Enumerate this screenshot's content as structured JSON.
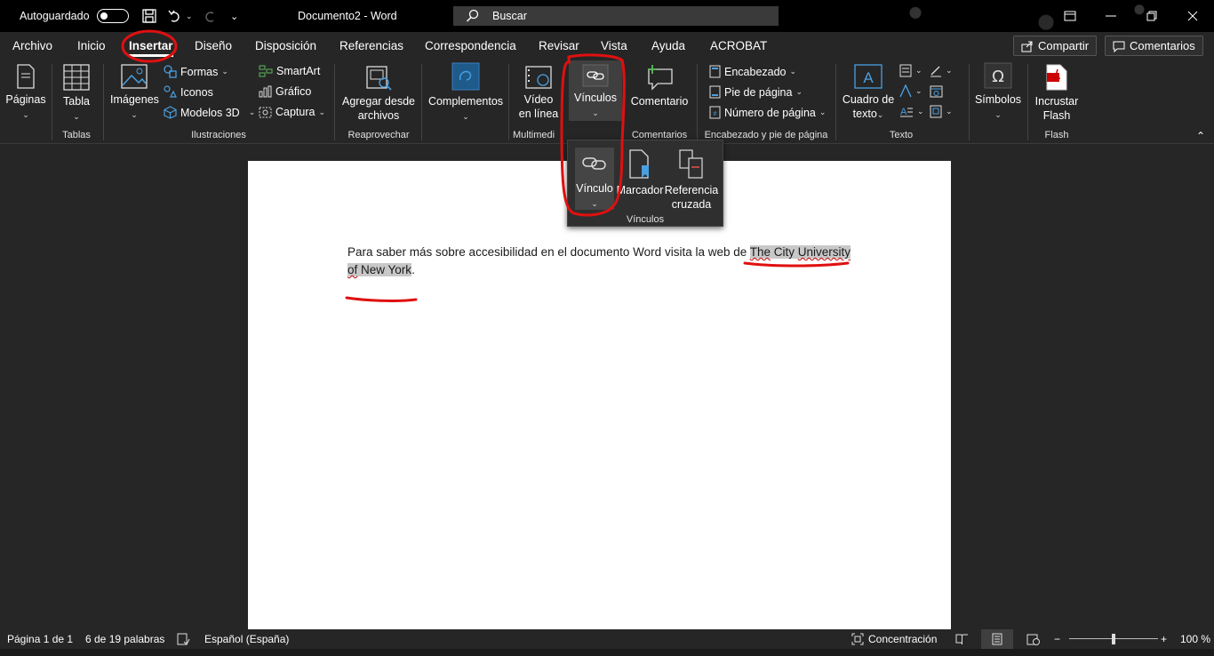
{
  "titlebar": {
    "autosave_label": "Autoguardado",
    "doc_title": "Documento2 - Word",
    "search_placeholder": "Buscar"
  },
  "menu": {
    "tabs": [
      "Archivo",
      "Inicio",
      "Insertar",
      "Diseño",
      "Disposición",
      "Referencias",
      "Correspondencia",
      "Revisar",
      "Vista",
      "Ayuda",
      "ACROBAT"
    ],
    "active_tab": "Insertar",
    "share_label": "Compartir",
    "comments_label": "Comentarios"
  },
  "ribbon": {
    "paginas": "Páginas",
    "tabla": "Tabla",
    "imagenes": "Imágenes",
    "formas": "Formas",
    "iconos": "Iconos",
    "modelos3d": "Modelos 3D",
    "smartart": "SmartArt",
    "grafico": "Gráfico",
    "captura": "Captura",
    "agregar_l1": "Agregar desde",
    "agregar_l2": "archivos",
    "complementos": "Complementos",
    "video_l1": "Vídeo",
    "video_l2": "en línea",
    "vinculos": "Vínculos",
    "comentario": "Comentario",
    "encabezado": "Encabezado",
    "pie_pagina": "Pie de página",
    "numero_pagina": "Número de página",
    "cuadro_l1": "Cuadro de",
    "cuadro_l2": "texto",
    "simbolos": "Símbolos",
    "flash_l1": "Incrustar",
    "flash_l2": "Flash",
    "groups": {
      "tablas": "Tablas",
      "ilustraciones": "Ilustraciones",
      "reaprovechar": "Reaprovechar",
      "multimedia": "Multimedi",
      "comentarios": "Comentarios",
      "encabezado_pie": "Encabezado y pie de página",
      "texto": "Texto",
      "flash": "Flash"
    }
  },
  "dropdown": {
    "vinculo": "Vínculo",
    "marcador": "Marcador",
    "referencia_l1": "Referencia",
    "referencia_l2": "cruzada",
    "group_label": "Vínculos"
  },
  "document": {
    "text_before": "Para saber más sobre accesibilidad en el documento Word visita la web de ",
    "link_part1": "The",
    "link_part2": " City ",
    "link_part3": "University",
    "link_part4": " ",
    "link_part5": "of",
    "link_part6": " New York",
    "text_after": "."
  },
  "status": {
    "page": "Página 1 de 1",
    "words": "6 de 19 palabras",
    "language": "Español (España)",
    "focus": "Concentración",
    "zoom": "100 %",
    "zoom_level": 1.0
  }
}
